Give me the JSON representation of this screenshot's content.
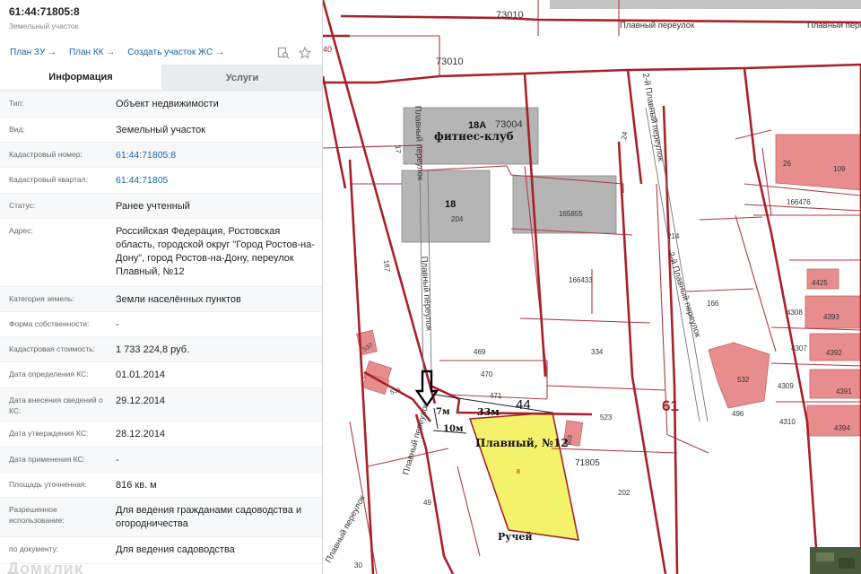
{
  "header": {
    "title": "61:44:71805:8",
    "subtitle": "Земельный участок"
  },
  "links": {
    "plan_zu": "План ЗУ →",
    "plan_kk": "План КК →",
    "create_zhs": "Создать участок ЖС →"
  },
  "tabs": {
    "info": "Информация",
    "services": "Услуги"
  },
  "info_rows": [
    {
      "label": "Тип:",
      "value": "Объект недвижимости"
    },
    {
      "label": "Вид:",
      "value": "Земельный участок"
    },
    {
      "label": "Кадастровый номер:",
      "value": "61:44:71805:8"
    },
    {
      "label": "Кадастровый квартал:",
      "value": "61:44:71805"
    },
    {
      "label": "Статус:",
      "value": "Ранее учтенный"
    },
    {
      "label": "Адрес:",
      "value": "Российская Федерация, Ростовская область, городской округ \"Город Ростов-на-Дону\", город Ростов-на-Дону, переулок Плавный, №12"
    },
    {
      "label": "Категория земель:",
      "value": "Земли населённых пунктов"
    },
    {
      "label": "Форма собственности:",
      "value": "-"
    },
    {
      "label": "Кадастровая стоимость:",
      "value": "1 733 224,8 руб."
    },
    {
      "label": "Дата определения КС:",
      "value": "01.01.2014"
    },
    {
      "label": "Дата внесения сведений о КС:",
      "value": "29.12.2014"
    },
    {
      "label": "Дата утверждения КС:",
      "value": "28.12.2014"
    },
    {
      "label": "Дата применения КС:",
      "value": "-"
    },
    {
      "label": "Площадь уточненная:",
      "value": "816 кв. м"
    },
    {
      "label": "Разрешенное использование:",
      "value": "Для ведения гражданами садоводства и огородничества"
    },
    {
      "label": "по документу:",
      "value": "Для ведения садоводства"
    }
  ],
  "watermark": "Домклик",
  "map": {
    "labels": {
      "q73010_top": "73010",
      "q73010": "73010",
      "q73004": "73004",
      "street_plavny_top": "Плавный переулок",
      "street_plavny_top2": "Плавный переулок",
      "street_2nd_plavny": "2-й Плавный переулок",
      "street_2nd_plavny2": "2-й Плавный переулок",
      "street_plavny_v": "Плавный переулок",
      "street_plavny_v2": "Плавный переулок",
      "street_plavny_diag": "Плавный переулок",
      "street_plavny_diag2": "Плавный переулок",
      "bld_18a": "18А",
      "fitness": "фитнес-клуб",
      "bld_18": "18",
      "n204": "204",
      "n165855": "165855",
      "n166433": "166433",
      "n214": "214",
      "n166": "166",
      "n26": "26",
      "n109": "109",
      "n166476": "166476",
      "n4425": "4425",
      "n4308": "4308",
      "n4393": "4393",
      "n4307": "4307",
      "n4392": "4392",
      "n4309": "4309",
      "n4391": "4391",
      "n4310": "4310",
      "n4394": "4394",
      "n532": "532",
      "n496": "496",
      "n61": "61",
      "n469": "469",
      "n470": "470",
      "n471": "471",
      "n334": "334",
      "n523": "523",
      "n503": "503",
      "n71805": "71805",
      "n202": "202",
      "n8": "8",
      "n49": "49",
      "n30": "30",
      "n537": "537",
      "n536": "536",
      "n17": "17",
      "n24": "24",
      "n187": "187",
      "n40": "40",
      "dim_44": "44",
      "dim_33": "33м",
      "dim_7": "7м",
      "dim_10": "10м",
      "plot_label": "Плавный, №12",
      "stream": "Ручей"
    },
    "colors": {
      "boundary": "#a8212a",
      "thin_line": "#b23a45",
      "plot_fill": "#f4f26a",
      "building_pink": "#e98e8f",
      "building_grey": "#b0b0b0"
    }
  }
}
